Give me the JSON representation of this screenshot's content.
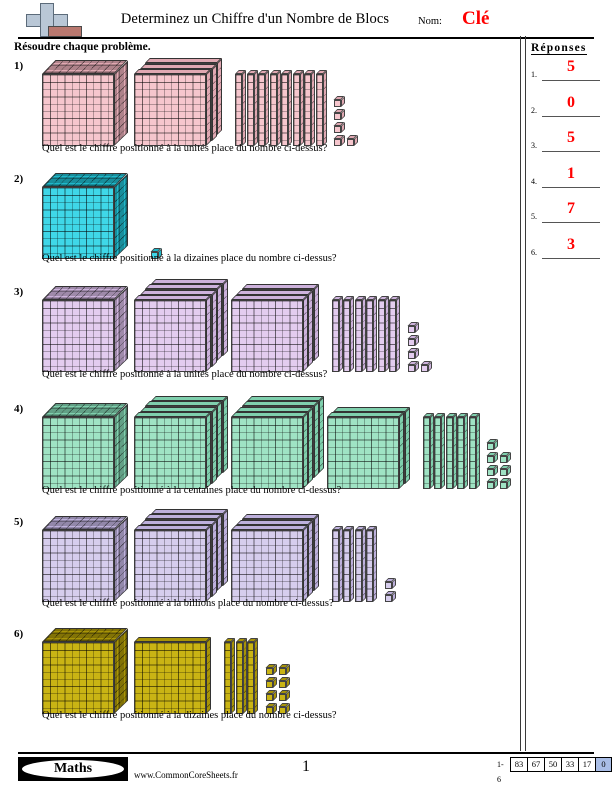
{
  "header": {
    "title": "Determinez un Chiffre d'un Nombre de Blocs",
    "name_label": "Nom:",
    "name_value": "Clé",
    "logo_icon": "plus-block-logo"
  },
  "instructions": "Résoudre chaque problème.",
  "answers": {
    "title": "Réponses",
    "items": [
      {
        "num": "1.",
        "value": "5"
      },
      {
        "num": "2.",
        "value": "0"
      },
      {
        "num": "3.",
        "value": "5"
      },
      {
        "num": "4.",
        "value": "1"
      },
      {
        "num": "5.",
        "value": "7"
      },
      {
        "num": "6.",
        "value": "3"
      }
    ],
    "answer_color": "#ff0000"
  },
  "problems": [
    {
      "num": "1)",
      "question": "Quel est le chiffre positionné à la unités place du nombre ci-dessus?",
      "color": "#f6c6cd",
      "color_dark": "#e0a8b2",
      "answer": "5",
      "blocks": {
        "cubes": 1,
        "flats": 3,
        "rods": 8,
        "units": 5
      }
    },
    {
      "num": "2)",
      "question": "Quel est le chiffre positionné à la dizaines place du nombre ci-dessus?",
      "color": "#3fd7e8",
      "color_dark": "#1fb8c9",
      "answer": "0",
      "blocks": {
        "cubes": 1,
        "flats": 0,
        "rods": 0,
        "units": 1
      }
    },
    {
      "num": "3)",
      "question": "Quel est le chiffre positionné à la unités place du nombre ci-dessus?",
      "color": "#e3ccef",
      "color_dark": "#cdb2dc",
      "answer": "5",
      "blocks": {
        "cubes": 1,
        "flats": 7,
        "rods": 6,
        "units": 5
      }
    },
    {
      "num": "4)",
      "question": "Quel est le chiffre positionné à la centaines place du nombre ci-dessus?",
      "color": "#9fe3c4",
      "color_dark": "#7fcfad",
      "answer": "1",
      "blocks": {
        "cubes": 1,
        "flats": 10,
        "rods": 5,
        "units": 7
      }
    },
    {
      "num": "5)",
      "question": "Quel est le chiffre positionné à la billions place du nombre ci-dessus?",
      "color": "#d6cded",
      "color_dark": "#bdb0dc",
      "answer": "7",
      "blocks": {
        "cubes": 1,
        "flats": 7,
        "rods": 4,
        "units": 2
      }
    },
    {
      "num": "6)",
      "question": "Quel est le chiffre positionné à la dizaines place du nombre ci-dessus?",
      "color": "#c9b414",
      "color_dark": "#a89407",
      "answer": "3",
      "blocks": {
        "cubes": 1,
        "flats": 1,
        "rods": 3,
        "units": 8
      }
    }
  ],
  "footer": {
    "brand": "Maths",
    "website": "www.CommonCoreSheets.fr",
    "page_number": "1",
    "scale_range": "1-6",
    "scale_values": [
      "83",
      "67",
      "50",
      "33",
      "17",
      "0"
    ],
    "scale_highlight_color": "#a9bde6"
  }
}
